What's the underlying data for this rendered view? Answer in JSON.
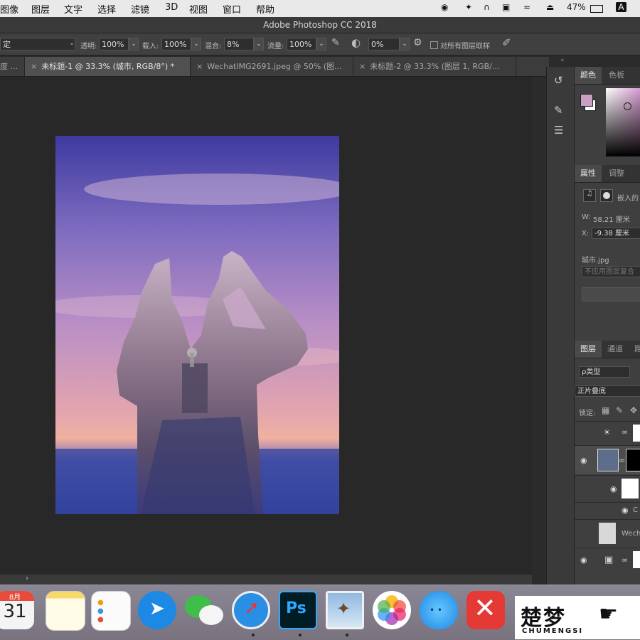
{
  "menubar": {
    "items": [
      "图像",
      "图层",
      "文字",
      "选择",
      "滤镜",
      "3D",
      "视图",
      "窗口",
      "帮助"
    ],
    "battery": "47%",
    "input_method": "A"
  },
  "window": {
    "title": "Adobe Photoshop CC 2018"
  },
  "options_bar": {
    "mode_value": "定",
    "opacity_label": "透明:",
    "opacity_value": "100%",
    "flow_label_left": "载入:",
    "flow_value_left": "100%",
    "blend_label": "混合:",
    "blend_value": "8%",
    "flow_label": "流量:",
    "flow_value": "100%",
    "angle_value": "0%",
    "sample_all_label": "对所有图层取样"
  },
  "tabs": [
    {
      "label": "度 ...",
      "active": false
    },
    {
      "label": "未标题-1 @ 33.3% (城市, RGB/8°) *",
      "active": true
    },
    {
      "label": "WechatIMG2691.jpeg @ 50% (图...",
      "active": false
    },
    {
      "label": "未标题-2 @ 33.3% (图层 1, RGB/...",
      "active": false
    }
  ],
  "color_panel": {
    "tabs": [
      "颜色",
      "色板"
    ],
    "fg_color": "#c9a0c3",
    "bg_color": "#ffffff"
  },
  "properties_panel": {
    "tabs": [
      "属性",
      "调整"
    ],
    "embed_label": "嵌入的",
    "w_label": "W:",
    "w_value": "58.21 厘米",
    "x_label": "X:",
    "x_value": "-9.38 厘米",
    "filename": "城市.jpg",
    "comp_placeholder": "不应用图层复合"
  },
  "layers_panel": {
    "tabs": [
      "图层",
      "通道",
      "路"
    ],
    "filter_label": "ρ类型",
    "blend_mode": "正片叠底",
    "lock_label": "锁定:",
    "layers": [
      {
        "name": "",
        "type": "adjustment",
        "visible": false
      },
      {
        "name": "",
        "type": "smart-object-masked",
        "visible": true
      },
      {
        "name": "",
        "type": "white-mask",
        "visible": true
      },
      {
        "name": "C",
        "type": "effect",
        "visible": true
      },
      {
        "name": "Wechat",
        "type": "image",
        "visible": false
      },
      {
        "name": "",
        "type": "background",
        "visible": true
      }
    ]
  },
  "dock": {
    "apps": [
      "Calendar",
      "Notes",
      "Reminders",
      "DingTalk",
      "WeChat",
      "Safari",
      "Photoshop",
      "Preview",
      "Photos",
      "QQ",
      "XMind"
    ],
    "calendar_month": "8月",
    "calendar_day": "31",
    "photoshop_label": "Ps"
  },
  "watermark": {
    "cn": "楚梦",
    "en": "CHUMENGSI"
  }
}
